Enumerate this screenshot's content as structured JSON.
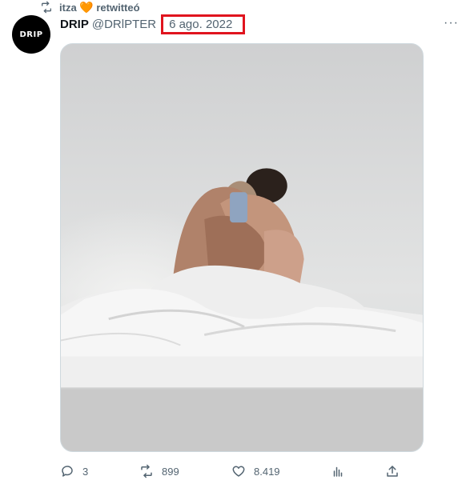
{
  "retweet": {
    "icon": "retweet-icon",
    "user": "itza",
    "emoji": "🧡",
    "label": "retwitteó"
  },
  "tweet": {
    "avatar_text": "DRIP",
    "display_name": "DRIP",
    "handle": "@DRlPTER",
    "date": "6 ago. 2022",
    "more": "···"
  },
  "media": {
    "icon": "photo"
  },
  "actions": {
    "replies": "3",
    "retweets": "899",
    "likes": "8.419",
    "views_icon": "analytics-icon",
    "share_icon": "share-icon"
  },
  "colors": {
    "highlight": "#e0141e",
    "muted": "#536471",
    "heart": "#f4900c"
  }
}
